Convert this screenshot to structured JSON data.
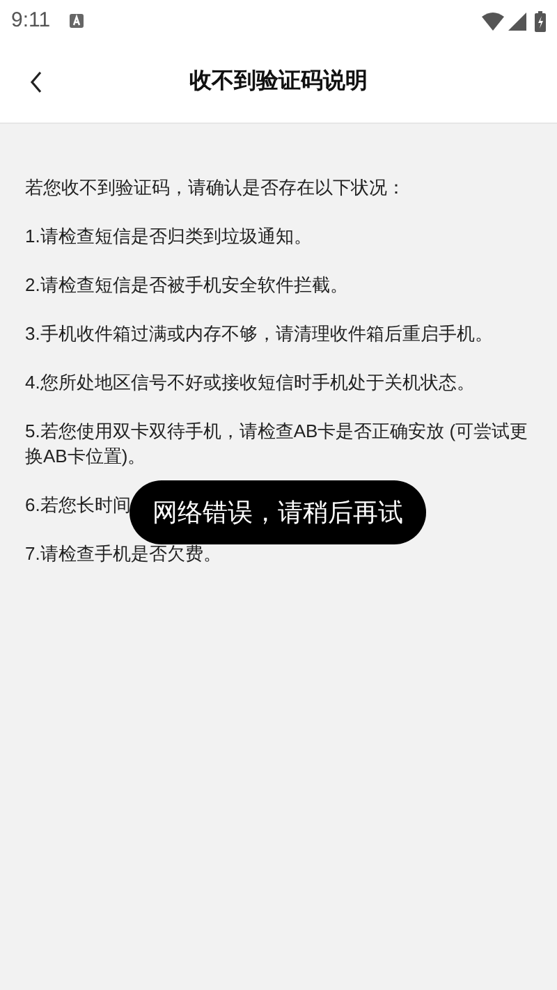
{
  "status_bar": {
    "time": "9:11"
  },
  "header": {
    "title": "收不到验证码说明"
  },
  "intro": "若您收不到验证码，请确认是否存在以下状况：",
  "items": [
    "1.请检查短信是否归类到垃圾通知。",
    "2.请检查短信是否被手机安全软件拦截。",
    "3.手机收件箱过满或内存不够，请清理收件箱后重启手机。",
    "4.您所处地区信号不好或接收短信时手机处于关机状态。",
    "5.若您使用双卡双待手机，请检查AB卡是否正确安放 (可尝试更换AB卡位置)。",
    "6.若您长时间",
    "7.请检查手机是否欠费。"
  ],
  "toast": "网络错误，请稍后再试"
}
